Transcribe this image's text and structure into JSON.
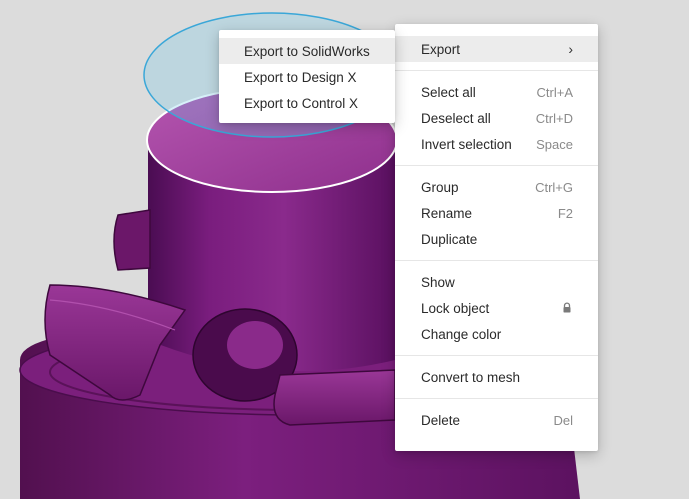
{
  "colors": {
    "background": "#dcdcdc",
    "model": "#7a1d7c",
    "selection_outline": "#3aa7d8",
    "menu_bg": "#ffffff",
    "hover_bg": "#ececec"
  },
  "submenu": {
    "items": [
      {
        "label": "Export to SolidWorks",
        "hovered": true
      },
      {
        "label": "Export to Design X"
      },
      {
        "label": "Export to Control X"
      }
    ]
  },
  "context_menu": {
    "export": {
      "label": "Export",
      "arrow": "›"
    },
    "selection": [
      {
        "label": "Select all",
        "shortcut": "Ctrl+A"
      },
      {
        "label": "Deselect all",
        "shortcut": "Ctrl+D"
      },
      {
        "label": "Invert selection",
        "shortcut": "Space"
      }
    ],
    "edit": [
      {
        "label": "Group",
        "shortcut": "Ctrl+G"
      },
      {
        "label": "Rename",
        "shortcut": "F2"
      },
      {
        "label": "Duplicate",
        "shortcut": ""
      }
    ],
    "visibility": [
      {
        "label": "Show",
        "shortcut": ""
      },
      {
        "label": "Lock object",
        "icon": "lock-icon"
      },
      {
        "label": "Change color",
        "shortcut": ""
      }
    ],
    "convert": {
      "label": "Convert to mesh"
    },
    "delete": {
      "label": "Delete",
      "shortcut": "Del"
    }
  }
}
